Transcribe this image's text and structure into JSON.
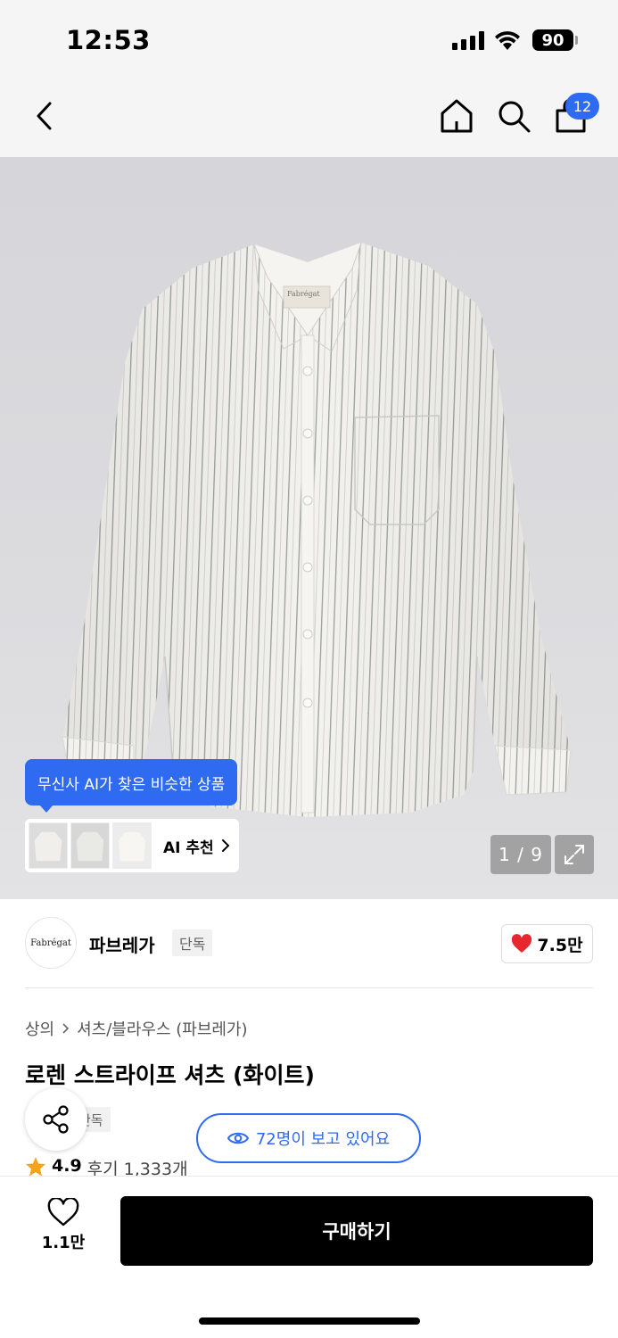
{
  "status_bar": {
    "time": "12:53",
    "battery": "90"
  },
  "nav": {
    "cart_count": "12"
  },
  "gallery": {
    "ai_tooltip": "무신사 AI가 찾은 비슷한 상품",
    "ai_recommend_label": "AI 추천",
    "page_indicator": "1 / 9",
    "shirt_label": "Fabrégat"
  },
  "brand": {
    "logo_text": "Fabrégat",
    "name": "파브레가",
    "tag": "단독",
    "like_count": "7.5만"
  },
  "product": {
    "breadcrumb": [
      "상의",
      "셔츠/블라우스 (파브레가)"
    ],
    "title": "로렌 스트라이프 셔츠 (화이트)",
    "exclusive_tag": "단독",
    "viewers_text": "72명이 보고 있어요",
    "rating": "4.9",
    "review_count": "후기 1,333개"
  },
  "bottom_bar": {
    "wish_count": "1.1만",
    "buy_label": "구매하기"
  },
  "colors": {
    "accent_blue": "#2f6bf0",
    "heart_red": "#e8262e",
    "star_orange": "#f7a21b"
  },
  "icons": [
    "back-icon",
    "home-icon",
    "search-icon",
    "shopping-bag-icon",
    "chevron-right-icon",
    "expand-icon",
    "heart-icon",
    "share-icon",
    "eye-icon",
    "star-icon"
  ]
}
